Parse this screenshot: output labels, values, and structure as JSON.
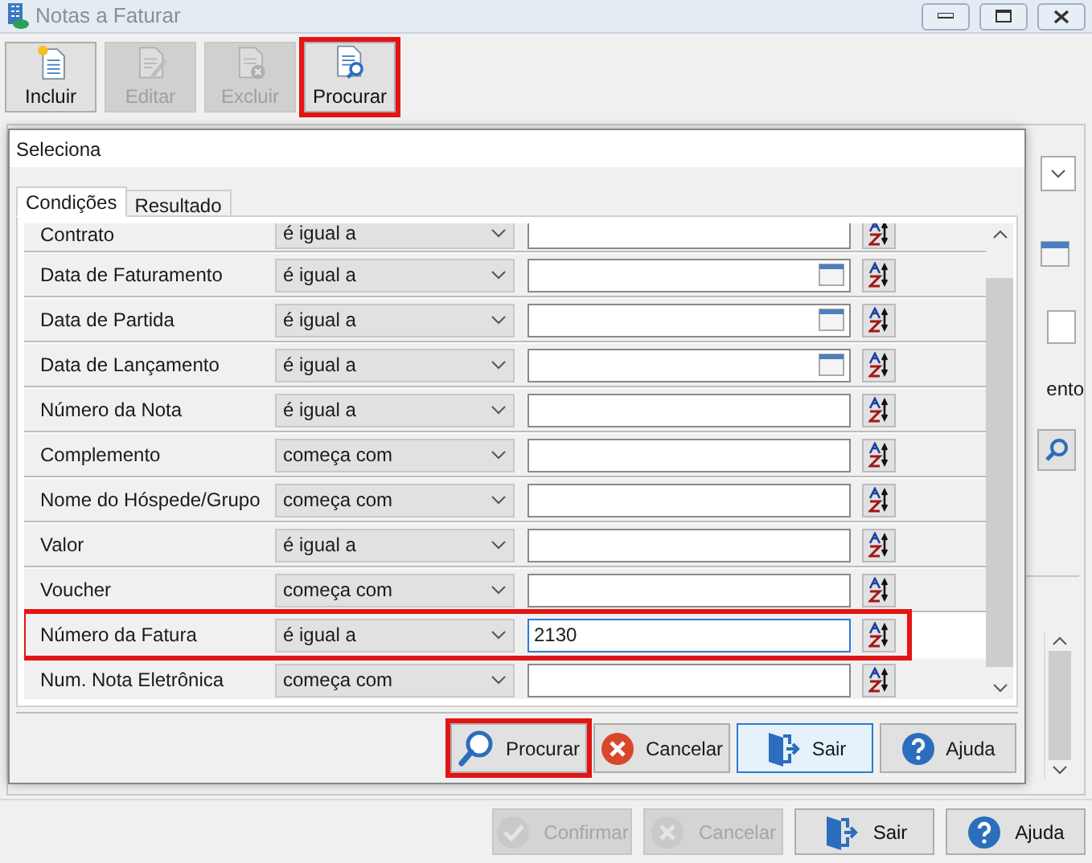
{
  "window": {
    "title": "Notas a Faturar"
  },
  "toolbar": [
    {
      "label": "Incluir",
      "kind": "new",
      "disabled": false,
      "highlighted": false
    },
    {
      "label": "Editar",
      "kind": "edit",
      "disabled": true,
      "highlighted": false
    },
    {
      "label": "Excluir",
      "kind": "delete",
      "disabled": true,
      "highlighted": false
    },
    {
      "label": "Procurar",
      "kind": "search",
      "disabled": false,
      "highlighted": true
    }
  ],
  "background": {
    "label_fragment": "ento"
  },
  "dialog": {
    "title": "Seleciona",
    "tabs": [
      {
        "label": "Condições",
        "selected": true
      },
      {
        "label": "Resultado",
        "selected": false
      }
    ],
    "conditions": [
      {
        "field": "Contrato",
        "operator": "é igual a",
        "kind": "text",
        "highlighted": false
      },
      {
        "field": "Data de Faturamento",
        "operator": "é igual a",
        "kind": "date",
        "highlighted": false
      },
      {
        "field": "Data de Partida",
        "operator": "é igual a",
        "kind": "date",
        "highlighted": false
      },
      {
        "field": "Data de Lançamento",
        "operator": "é igual a",
        "kind": "date",
        "highlighted": false
      },
      {
        "field": "Número da Nota",
        "operator": "é igual a",
        "kind": "text",
        "highlighted": false
      },
      {
        "field": "Complemento",
        "operator": "começa com",
        "kind": "text",
        "highlighted": false
      },
      {
        "field": "Nome do Hóspede/Grupo",
        "operator": "começa com",
        "kind": "text",
        "highlighted": false
      },
      {
        "field": "Valor",
        "operator": "é igual a",
        "kind": "text",
        "highlighted": false
      },
      {
        "field": "Voucher",
        "operator": "começa com",
        "kind": "text",
        "highlighted": false
      },
      {
        "field": "Número da Fatura",
        "operator": "é igual a",
        "kind": "text",
        "value": "2130",
        "highlighted": true
      },
      {
        "field": "Num. Nota Eletrônica",
        "operator": "começa com",
        "kind": "text",
        "highlighted": false
      }
    ],
    "buttons": [
      {
        "label": "Procurar",
        "kind": "search",
        "highlighted": true,
        "focused": false
      },
      {
        "label": "Cancelar",
        "kind": "cancel",
        "highlighted": false,
        "focused": false
      },
      {
        "label": "Sair",
        "kind": "exit",
        "highlighted": false,
        "focused": true
      },
      {
        "label": "Ajuda",
        "kind": "help",
        "highlighted": false,
        "focused": false
      }
    ]
  },
  "footer_buttons": [
    {
      "label": "Confirmar",
      "kind": "check",
      "disabled": true
    },
    {
      "label": "Cancelar",
      "kind": "cancel",
      "disabled": true
    },
    {
      "label": "Sair",
      "kind": "exit",
      "disabled": false
    },
    {
      "label": "Ajuda",
      "kind": "help",
      "disabled": false
    }
  ]
}
